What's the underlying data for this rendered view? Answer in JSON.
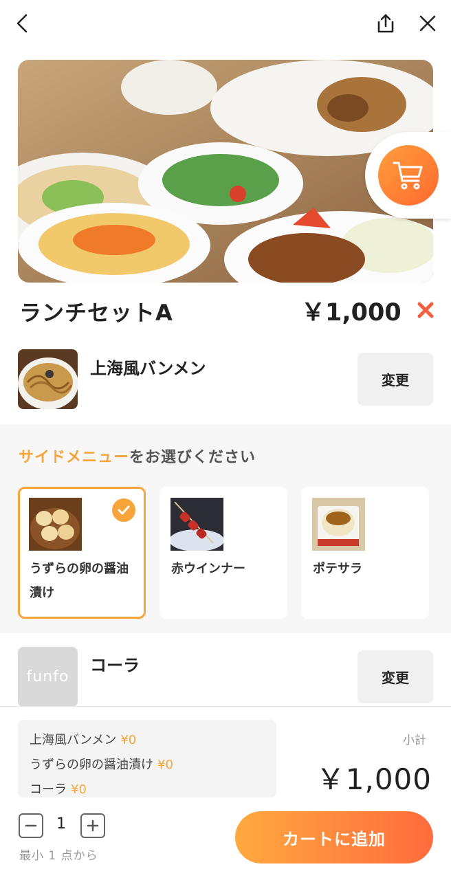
{
  "header": {
    "back_icon": "chevron-left-icon",
    "share_icon": "share-icon",
    "close_icon": "close-icon"
  },
  "product": {
    "title": "ランチセットA",
    "price": "￥1,000"
  },
  "main_item": {
    "name": "上海風バンメン",
    "change_label": "変更"
  },
  "side_menu": {
    "heading_accent": "サイドメニュー",
    "heading_rest": "をお選びください",
    "options": [
      {
        "name": "うずらの卵の醤油漬け",
        "selected": true
      },
      {
        "name": "赤ウインナー",
        "selected": false
      },
      {
        "name": "ポテサラ",
        "selected": false
      }
    ]
  },
  "drink_item": {
    "name": "コーラ",
    "thumb_text": "funfo",
    "change_label": "変更"
  },
  "summary": {
    "lines": [
      {
        "name": "上海風バンメン",
        "price": "¥0"
      },
      {
        "name": "うずらの卵の醤油漬け",
        "price": "¥0"
      },
      {
        "name": "コーラ",
        "price": "¥0"
      }
    ],
    "subtotal_label": "小計",
    "subtotal": "￥1,000"
  },
  "quantity": {
    "value": "1",
    "min_note": "最小 1 点から"
  },
  "add_to_cart_label": "カートに追加",
  "colors": {
    "accent": "#f7a43a",
    "gradient_start": "#ffa93f",
    "gradient_end": "#ff6b3d",
    "remove": "#f06040"
  }
}
